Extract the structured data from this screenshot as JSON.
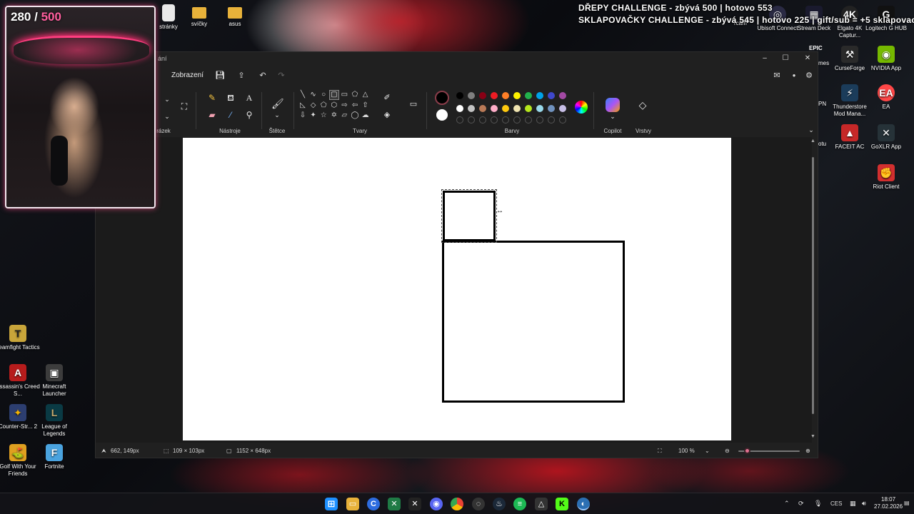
{
  "overlay": {
    "challenge_line1": "DŘEPY CHALLENGE - zbývá 500 | hotovo 553",
    "challenge_line2": "SKLAPOVAČKY CHALLENGE - zbývá 545 | hotovo 225 | gift/sub = +5 sklapovacek",
    "counter_current": "280",
    "counter_separator": "/",
    "counter_max": "500"
  },
  "desktop": {
    "top_icons": [
      {
        "label": "stránky",
        "icon": "file-icon"
      },
      {
        "label": "svíčky",
        "icon": "folder-icon"
      },
      {
        "label": "asus",
        "icon": "folder-icon"
      }
    ],
    "right_icons": [
      {
        "label": "Ubisoft Connect",
        "icon": "ubisoft-icon"
      },
      {
        "label": "Stream Deck",
        "icon": "stream-deck-icon"
      },
      {
        "label": "Elgato 4K Captur...",
        "icon": "elgato-icon"
      },
      {
        "label": "Logitech G HUB",
        "icon": "logitech-icon"
      },
      {
        "label": "CurseForge",
        "icon": "curseforge-icon"
      },
      {
        "label": "NVIDIA App",
        "icon": "nvidia-icon"
      },
      {
        "label": "Thunderstore Mod Mana...",
        "icon": "thunderstore-icon"
      },
      {
        "label": "EA",
        "icon": "ea-icon"
      },
      {
        "label": "FACEIT AC",
        "icon": "faceit-icon"
      },
      {
        "label": "GoXLR App",
        "icon": "goxlr-icon"
      },
      {
        "label": "Riot Client",
        "icon": "riot-icon"
      }
    ],
    "left_icons": [
      {
        "label": "Teamfight Tactics",
        "icon": "tft-icon"
      },
      {
        "label": "Assassin's Creed S...",
        "icon": "assassins-creed-icon"
      },
      {
        "label": "Minecraft Launcher",
        "icon": "minecraft-icon"
      },
      {
        "label": "Counter-Str... 2",
        "icon": "cs2-icon"
      },
      {
        "label": "League of Legends",
        "icon": "lol-icon"
      },
      {
        "label": "Golf With Your Friends",
        "icon": "golf-icon"
      },
      {
        "label": "Fortnite",
        "icon": "fortnite-icon"
      }
    ],
    "partial_labels": {
      "pn": "PN",
      "otu": "otu",
      "mes": "mes",
      "epic": "EPIC",
      "rcam": "rcam"
    }
  },
  "paint": {
    "title_fragment": "ání",
    "menu_view": "Zobrazení",
    "groups": {
      "image": "rázek",
      "tools": "Nástroje",
      "brushes": "Štětce",
      "shapes": "Tvary",
      "colors": "Barvy",
      "copilot": "Copilot",
      "layers": "Vrstvy"
    },
    "palette_row1": [
      "#000000",
      "#7f7f7f",
      "#880015",
      "#ed1c24",
      "#ff7f27",
      "#fff200",
      "#22b14c",
      "#00a2e8",
      "#3f48cc",
      "#a349a4"
    ],
    "palette_row2": [
      "#ffffff",
      "#c3c3c3",
      "#b97a57",
      "#ffaec9",
      "#ffc90e",
      "#efe4b0",
      "#b5e61d",
      "#99d9ea",
      "#7092be",
      "#c8bfe7"
    ],
    "status": {
      "cursor_pos": "662, 149px",
      "selection_size": "109 × 103px",
      "canvas_size": "1152 × 648px",
      "zoom": "100 %"
    }
  },
  "taskbar": {
    "language": "CES",
    "time": "18:07",
    "date": "27.02.2026"
  }
}
